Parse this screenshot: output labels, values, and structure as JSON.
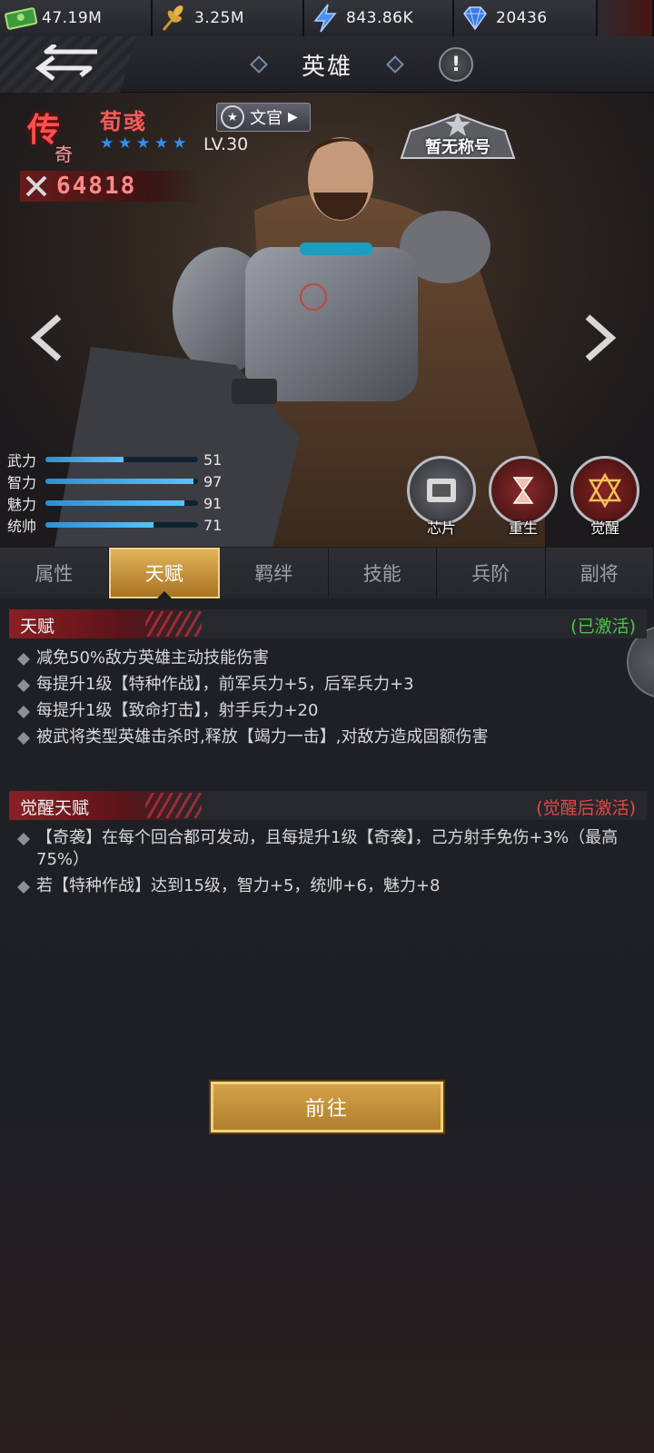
{
  "resources": [
    {
      "icon": "cash-icon",
      "value": "47.19M"
    },
    {
      "icon": "wheat-icon",
      "value": "3.25M"
    },
    {
      "icon": "energy-icon",
      "value": "843.86K"
    },
    {
      "icon": "diamond-icon",
      "value": "20436"
    }
  ],
  "header": {
    "title": "英雄",
    "info": "!"
  },
  "hero": {
    "rarity_top": "传",
    "rarity_bottom": "奇",
    "name": "荀彧",
    "role": "文官",
    "level": "LV.30",
    "stars": 5,
    "power": "64818",
    "title_badge": "暂无称号",
    "stats": [
      {
        "label": "武力",
        "value": "51",
        "ratio": 0.51
      },
      {
        "label": "智力",
        "value": "97",
        "ratio": 0.97
      },
      {
        "label": "魅力",
        "value": "91",
        "ratio": 0.91
      },
      {
        "label": "统帅",
        "value": "71",
        "ratio": 0.71
      }
    ],
    "actions": [
      {
        "label": "芯片",
        "icon": "chip-icon"
      },
      {
        "label": "重生",
        "icon": "rebirth-icon"
      },
      {
        "label": "觉醒",
        "icon": "awaken-icon"
      }
    ]
  },
  "tabs": [
    {
      "label": "属性",
      "active": false
    },
    {
      "label": "天赋",
      "active": true
    },
    {
      "label": "羁绊",
      "active": false
    },
    {
      "label": "技能",
      "active": false
    },
    {
      "label": "兵阶",
      "active": false
    },
    {
      "label": "副将",
      "active": false
    }
  ],
  "talent": {
    "title": "天赋",
    "status": "(已激活)",
    "status_color": "#4cc44c",
    "items": [
      "减免50%敌方英雄主动技能伤害",
      "每提升1级【特种作战】，前军兵力+5，后军兵力+3",
      "每提升1级【致命打击】，射手兵力+20",
      "被武将类型英雄击杀时,释放【竭力一击】,对敌方造成固额伤害"
    ]
  },
  "awaken_talent": {
    "title": "觉醒天赋",
    "status": "(觉醒后激活)",
    "status_color": "#e04848",
    "items": [
      "【奇袭】在每个回合都可发动，且每提升1级【奇袭】，己方射手免伤+3%（最高75%）",
      "若【特种作战】达到15级，智力+5，统帅+6，魅力+8"
    ]
  },
  "go_button": "前往"
}
